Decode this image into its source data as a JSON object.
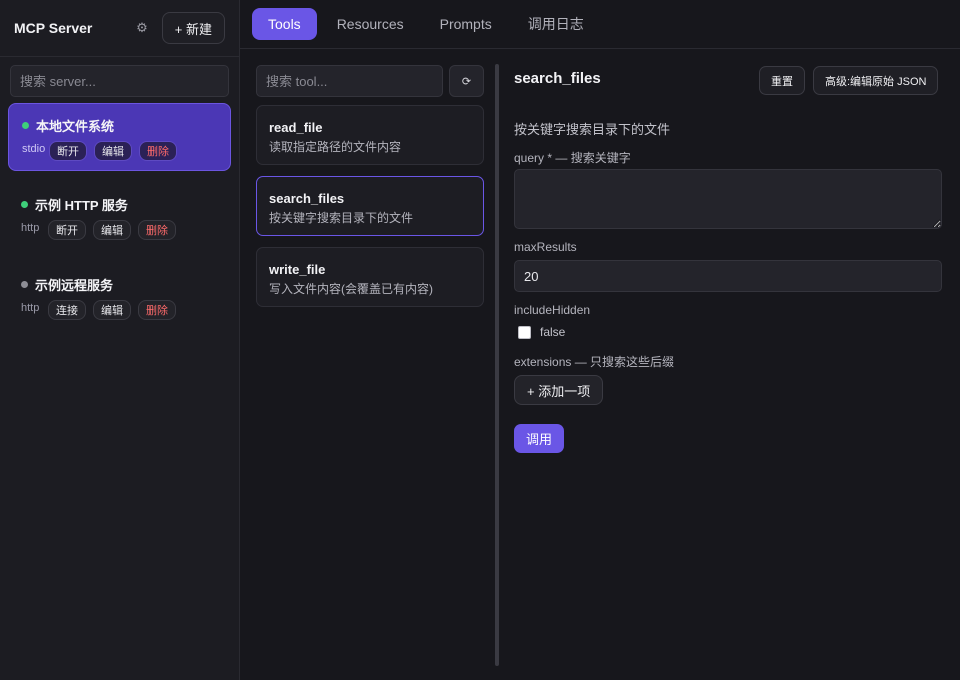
{
  "sidebar": {
    "title": "MCP Server",
    "settings_icon": "gear-icon",
    "new_label": "+ 新建",
    "search_placeholder": "搜索 server...",
    "servers": [
      {
        "name": "本地文件系统",
        "type": "stdio",
        "status": "connected",
        "action": "断开",
        "edit": "编辑",
        "delete": "删除"
      },
      {
        "name": "示例 HTTP 服务",
        "type": "http",
        "status": "connected",
        "action": "断开",
        "edit": "编辑",
        "delete": "删除"
      },
      {
        "name": "示例远程服务",
        "type": "http",
        "status": "disconnected",
        "action": "连接",
        "edit": "编辑",
        "delete": "删除"
      }
    ]
  },
  "tabs": [
    "Tools",
    "Resources",
    "Prompts",
    "调用日志"
  ],
  "tools_panel": {
    "search_placeholder": "搜索 tool...",
    "refresh_glyph": "⟳",
    "tools": [
      {
        "name": "read_file",
        "desc": "读取指定路径的文件内容"
      },
      {
        "name": "search_files",
        "desc": "按关键字搜索目录下的文件"
      },
      {
        "name": "write_file",
        "desc": "写入文件内容(会覆盖已有内容)"
      }
    ]
  },
  "detail": {
    "title": "search_files",
    "reset_label": "重置",
    "advanced_label": "高级:编辑原始 JSON",
    "description": "按关键字搜索目录下的文件",
    "query_label": "query * — 搜索关键字",
    "max_label": "maxResults",
    "max_value": "20",
    "hidden_label": "includeHidden",
    "hidden_value": "false",
    "ext_label": "extensions — 只搜索这些后缀",
    "add_label": "+ 添加一项",
    "call_label": "调用"
  },
  "colors": {
    "accent": "#6a56e6",
    "active_server": "#4b37b5",
    "online": "#3ecf7a",
    "offline": "#8d8d95",
    "danger": "#ff6b6b"
  }
}
